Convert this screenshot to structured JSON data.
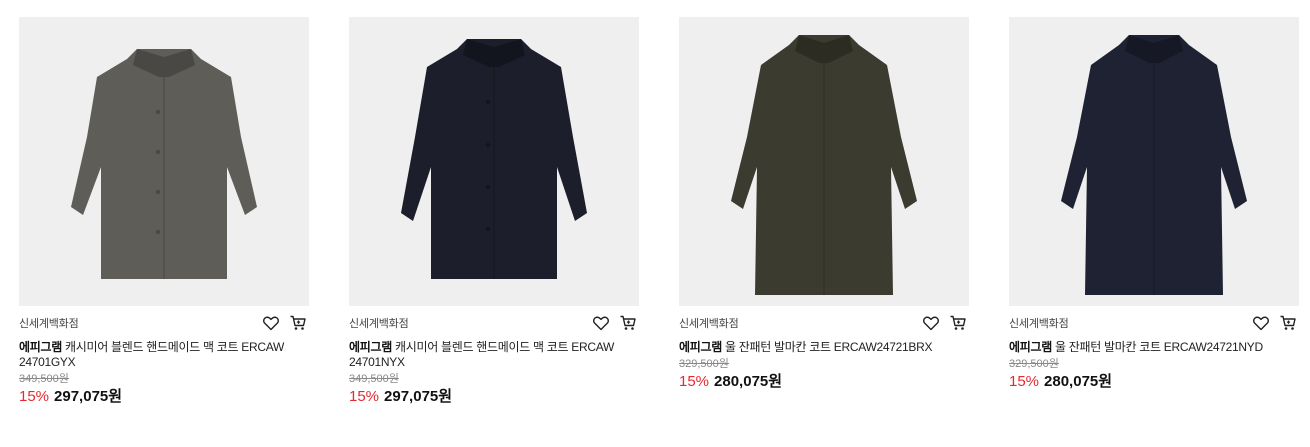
{
  "products": [
    {
      "store": "신세계백화점",
      "brand": "에피그램",
      "name": "캐시미어 블렌드 핸드메이드 맥 코트 ERCAW 24701GYX",
      "original_price": "349,500원",
      "discount": "15%",
      "price": "297,075원",
      "coat_color": "#5f5d58",
      "coat_shade": "#4a4844"
    },
    {
      "store": "신세계백화점",
      "brand": "에피그램",
      "name": "캐시미어 블렌드 핸드메이드 맥 코트 ERCAW 24701NYX",
      "original_price": "349,500원",
      "discount": "15%",
      "price": "297,075원",
      "coat_color": "#1c1f2b",
      "coat_shade": "#13151e"
    },
    {
      "store": "신세계백화점",
      "brand": "에피그램",
      "name": "울 잔패턴 발마칸 코트 ERCAW24721BRX",
      "original_price": "329,500원",
      "discount": "15%",
      "price": "280,075원",
      "coat_color": "#3b3b2f",
      "coat_shade": "#2c2c23"
    },
    {
      "store": "신세계백화점",
      "brand": "에피그램",
      "name": "울 잔패턴 발마칸 코트 ERCAW24721NYD",
      "original_price": "329,500원",
      "discount": "15%",
      "price": "280,075원",
      "coat_color": "#1f2232",
      "coat_shade": "#161825"
    }
  ],
  "icons": {
    "wishlist": "heart-icon",
    "cart": "cart-icon"
  },
  "colors": {
    "discount": "#e5292f",
    "thumb_bg": "#efefef"
  }
}
